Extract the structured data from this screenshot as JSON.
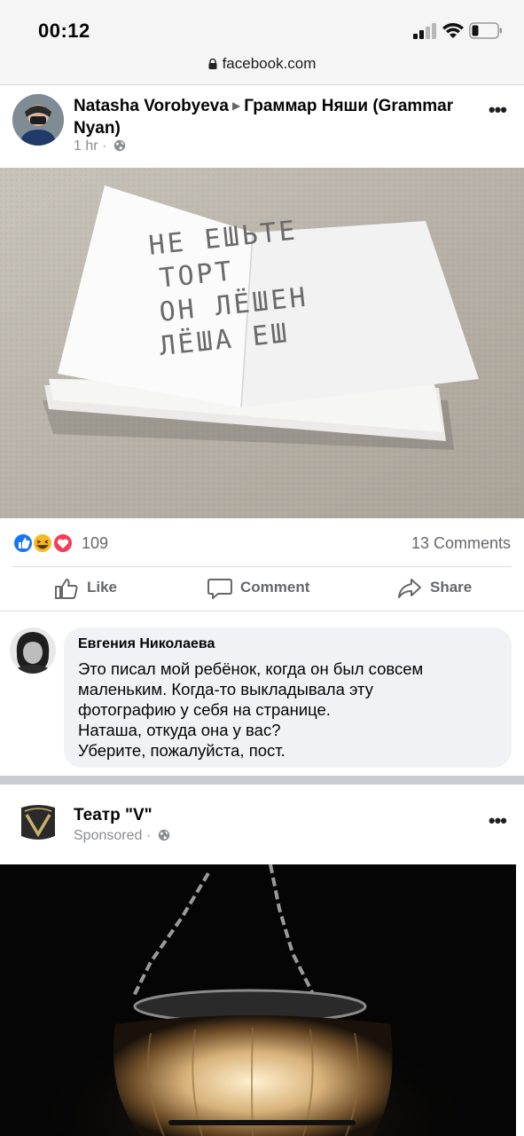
{
  "status_bar": {
    "time": "00:12"
  },
  "browser": {
    "url": "facebook.com"
  },
  "post": {
    "author": "Natasha Vorobyeva",
    "group": "Граммар Няши (Grammar Nyan)",
    "time": "1 hr ·",
    "more_label": "•••",
    "photo_text": [
      "НЕ ЕШЬТЕ",
      "ТОРТ",
      "ОН ЛЁШЕН",
      "ЛЁША ЕШ"
    ],
    "reaction_count": "109",
    "comments_count": "13 Comments",
    "actions": {
      "like": "Like",
      "comment": "Comment",
      "share": "Share"
    }
  },
  "comment": {
    "author": "Евгения Николаева",
    "lines": [
      "Это писал мой ребёнок, когда он был совсем",
      "маленьким. Когда-то выкладывала эту",
      "фотографию у себя на странице.",
      "Наташа, откуда она у вас?",
      "Уберите, пожалуйста, пост."
    ]
  },
  "ad": {
    "name": "Театр \"V\"",
    "meta": "Sponsored ·",
    "more_label": "•••"
  },
  "colors": {
    "link_blue": "#1877f2",
    "muted": "#65676b",
    "bubble": "#f0f2f5",
    "love_red": "#f33e58",
    "haha_yellow": "#f7b928"
  },
  "icons": [
    "lock-icon",
    "globe-icon",
    "like-icon",
    "comment-icon",
    "share-icon",
    "wifi-icon",
    "battery-icon",
    "signal-icon"
  ]
}
